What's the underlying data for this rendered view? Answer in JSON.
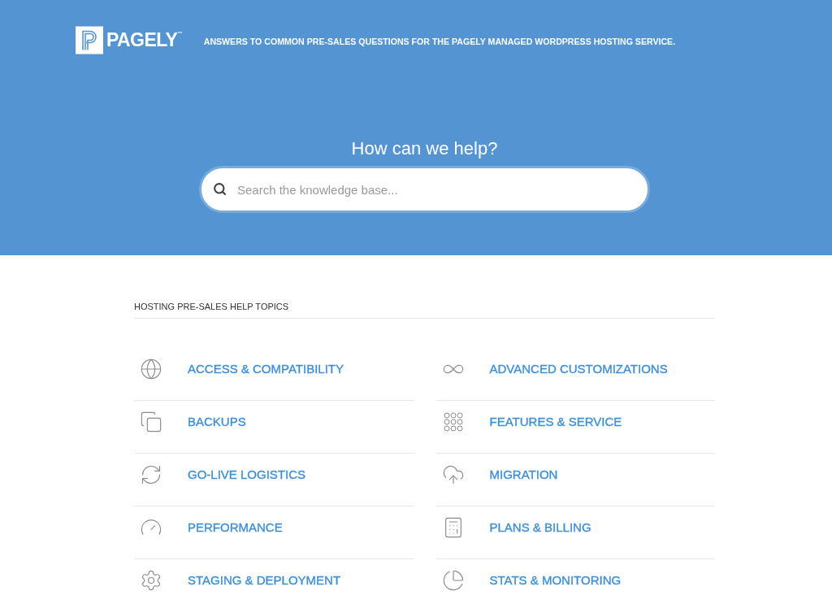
{
  "header": {
    "logo": {
      "wordmark": "PAGELY$^{™}$"
    },
    "tagline": "ANSWERS TO COMMON PRE-SALES QUESTIONS FOR THE PAGELY MANAGED WORDPRESS HOSTING SERVICE.",
    "title": "How can we help?",
    "search": {
      "placeholder": "Search the knowledge base..."
    }
  },
  "topics": {
    "heading": "HOSTING PRE-SALES HELP TOPICS",
    "items": [
      {
        "label": "ACCESS & COMPATIBILITY"
      },
      {
        "label": "ADVANCED CUSTOMIZATIONS"
      },
      {
        "label": "BACKUPS"
      },
      {
        "label": "FEATURES & SERVICE"
      },
      {
        "label": "GO-LIVE LOGISTICS"
      },
      {
        "label": "MIGRATION"
      },
      {
        "label": "PERFORMANCE"
      },
      {
        "label": "PLANS & BILLING"
      },
      {
        "label": "STAGING & DEPLOYMENT"
      },
      {
        "label": "STATS & MONITORING"
      }
    ]
  }
}
